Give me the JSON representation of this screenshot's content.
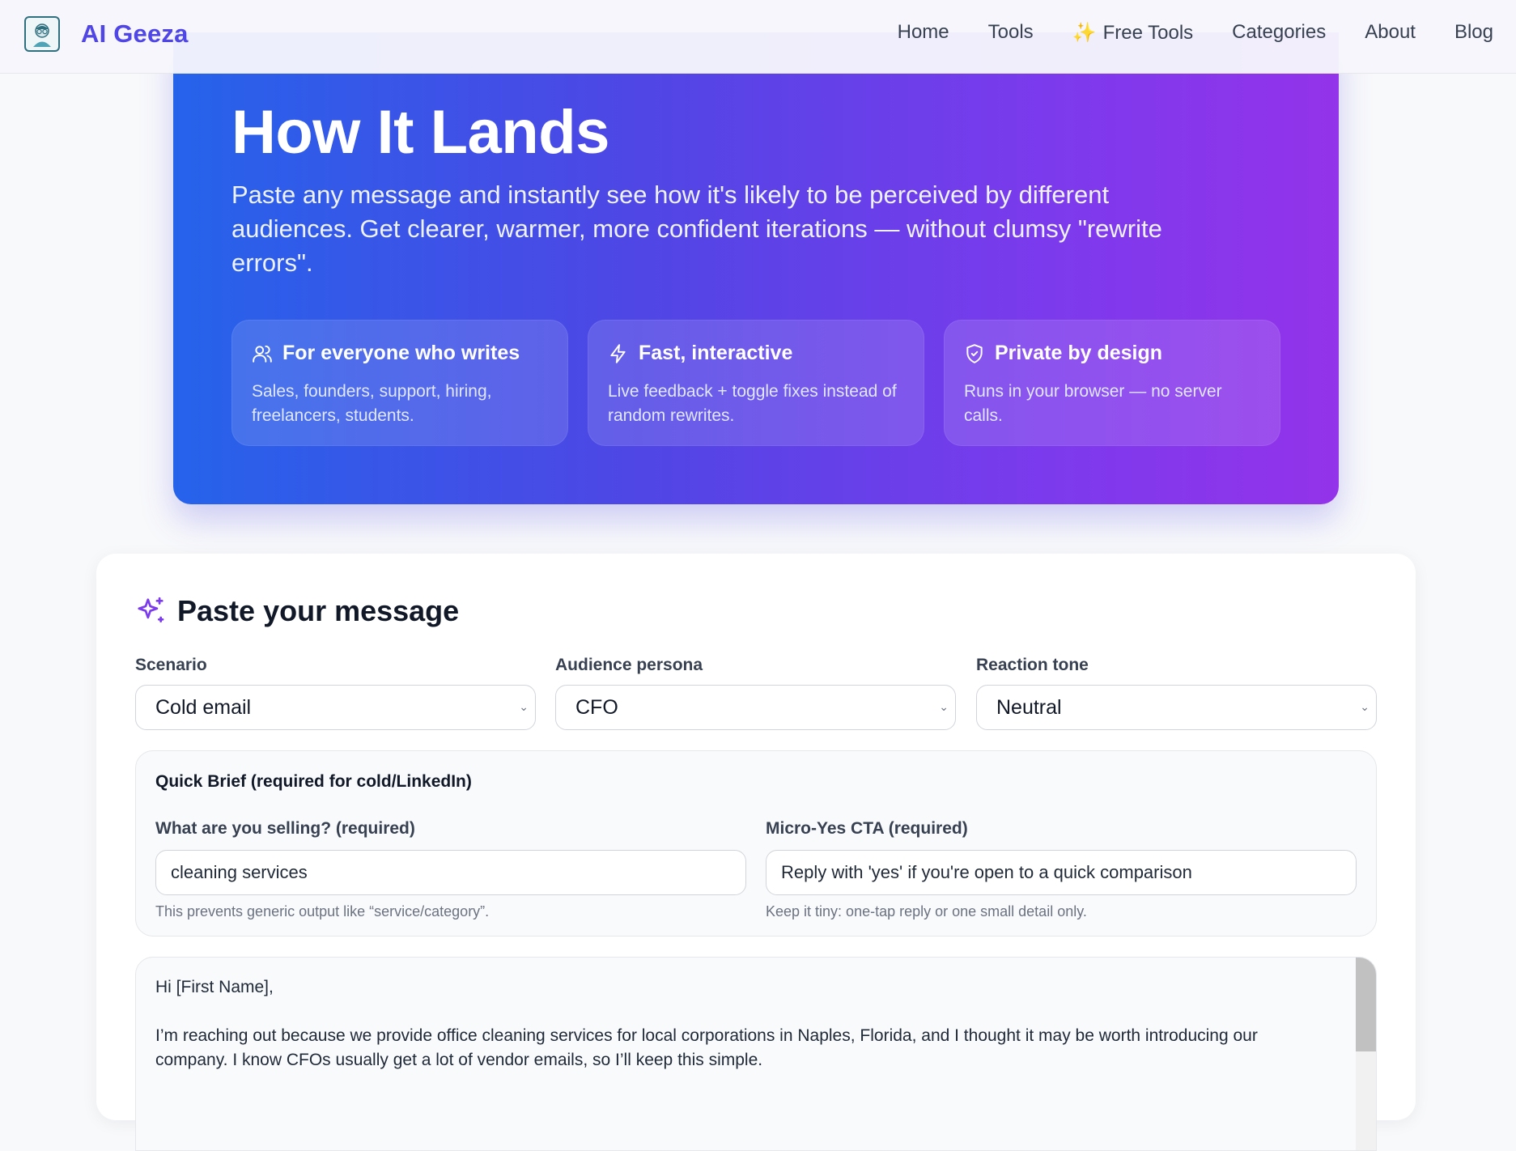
{
  "header": {
    "brand": "AI Geeza",
    "nav": {
      "home": "Home",
      "tools": "Tools",
      "free_tools": "Free Tools",
      "free_tools_icon": "sparkles-icon",
      "categories": "Categories",
      "about": "About",
      "blog": "Blog"
    }
  },
  "hero": {
    "title": "How It Lands",
    "lead": "Paste any message and instantly see how it's likely to be perceived by different audiences. Get clearer, warmer, more confident iterations — without clumsy \"rewrite errors\".",
    "features": [
      {
        "icon": "users-icon",
        "title": "For everyone who writes",
        "desc": "Sales, founders, support, hiring, freelancers, students."
      },
      {
        "icon": "bolt-icon",
        "title": "Fast, interactive",
        "desc": "Live feedback + toggle fixes instead of random rewrites."
      },
      {
        "icon": "shield-check-icon",
        "title": "Private by design",
        "desc": "Runs in your browser — no server calls."
      }
    ]
  },
  "editor": {
    "title": "Paste your message",
    "scenario": {
      "label": "Scenario",
      "value": "Cold email"
    },
    "persona": {
      "label": "Audience persona",
      "value": "CFO"
    },
    "tone": {
      "label": "Reaction tone",
      "value": "Neutral"
    },
    "brief": {
      "title": "Quick Brief (required for cold/LinkedIn)",
      "selling_label": "What are you selling? (required)",
      "selling_value": "cleaning services",
      "selling_hint": "This prevents generic output like “service/category”.",
      "cta_label": "Micro-Yes CTA (required)",
      "cta_value": "Reply with 'yes' if you're open to a quick comparison",
      "cta_hint": "Keep it tiny: one-tap reply or one small detail only."
    },
    "message": {
      "line1": "Hi [First Name],",
      "line2": "I’m reaching out because we provide office cleaning services for local corporations in Naples, Florida, and I thought it may be worth introducing our company. I know CFOs usually get a lot of vendor emails, so I’ll keep this simple."
    }
  },
  "colors": {
    "brand": "#4f46e5",
    "hero_start": "#2563eb",
    "hero_end": "#9333ea",
    "accent_icon": "#7c3aed"
  }
}
